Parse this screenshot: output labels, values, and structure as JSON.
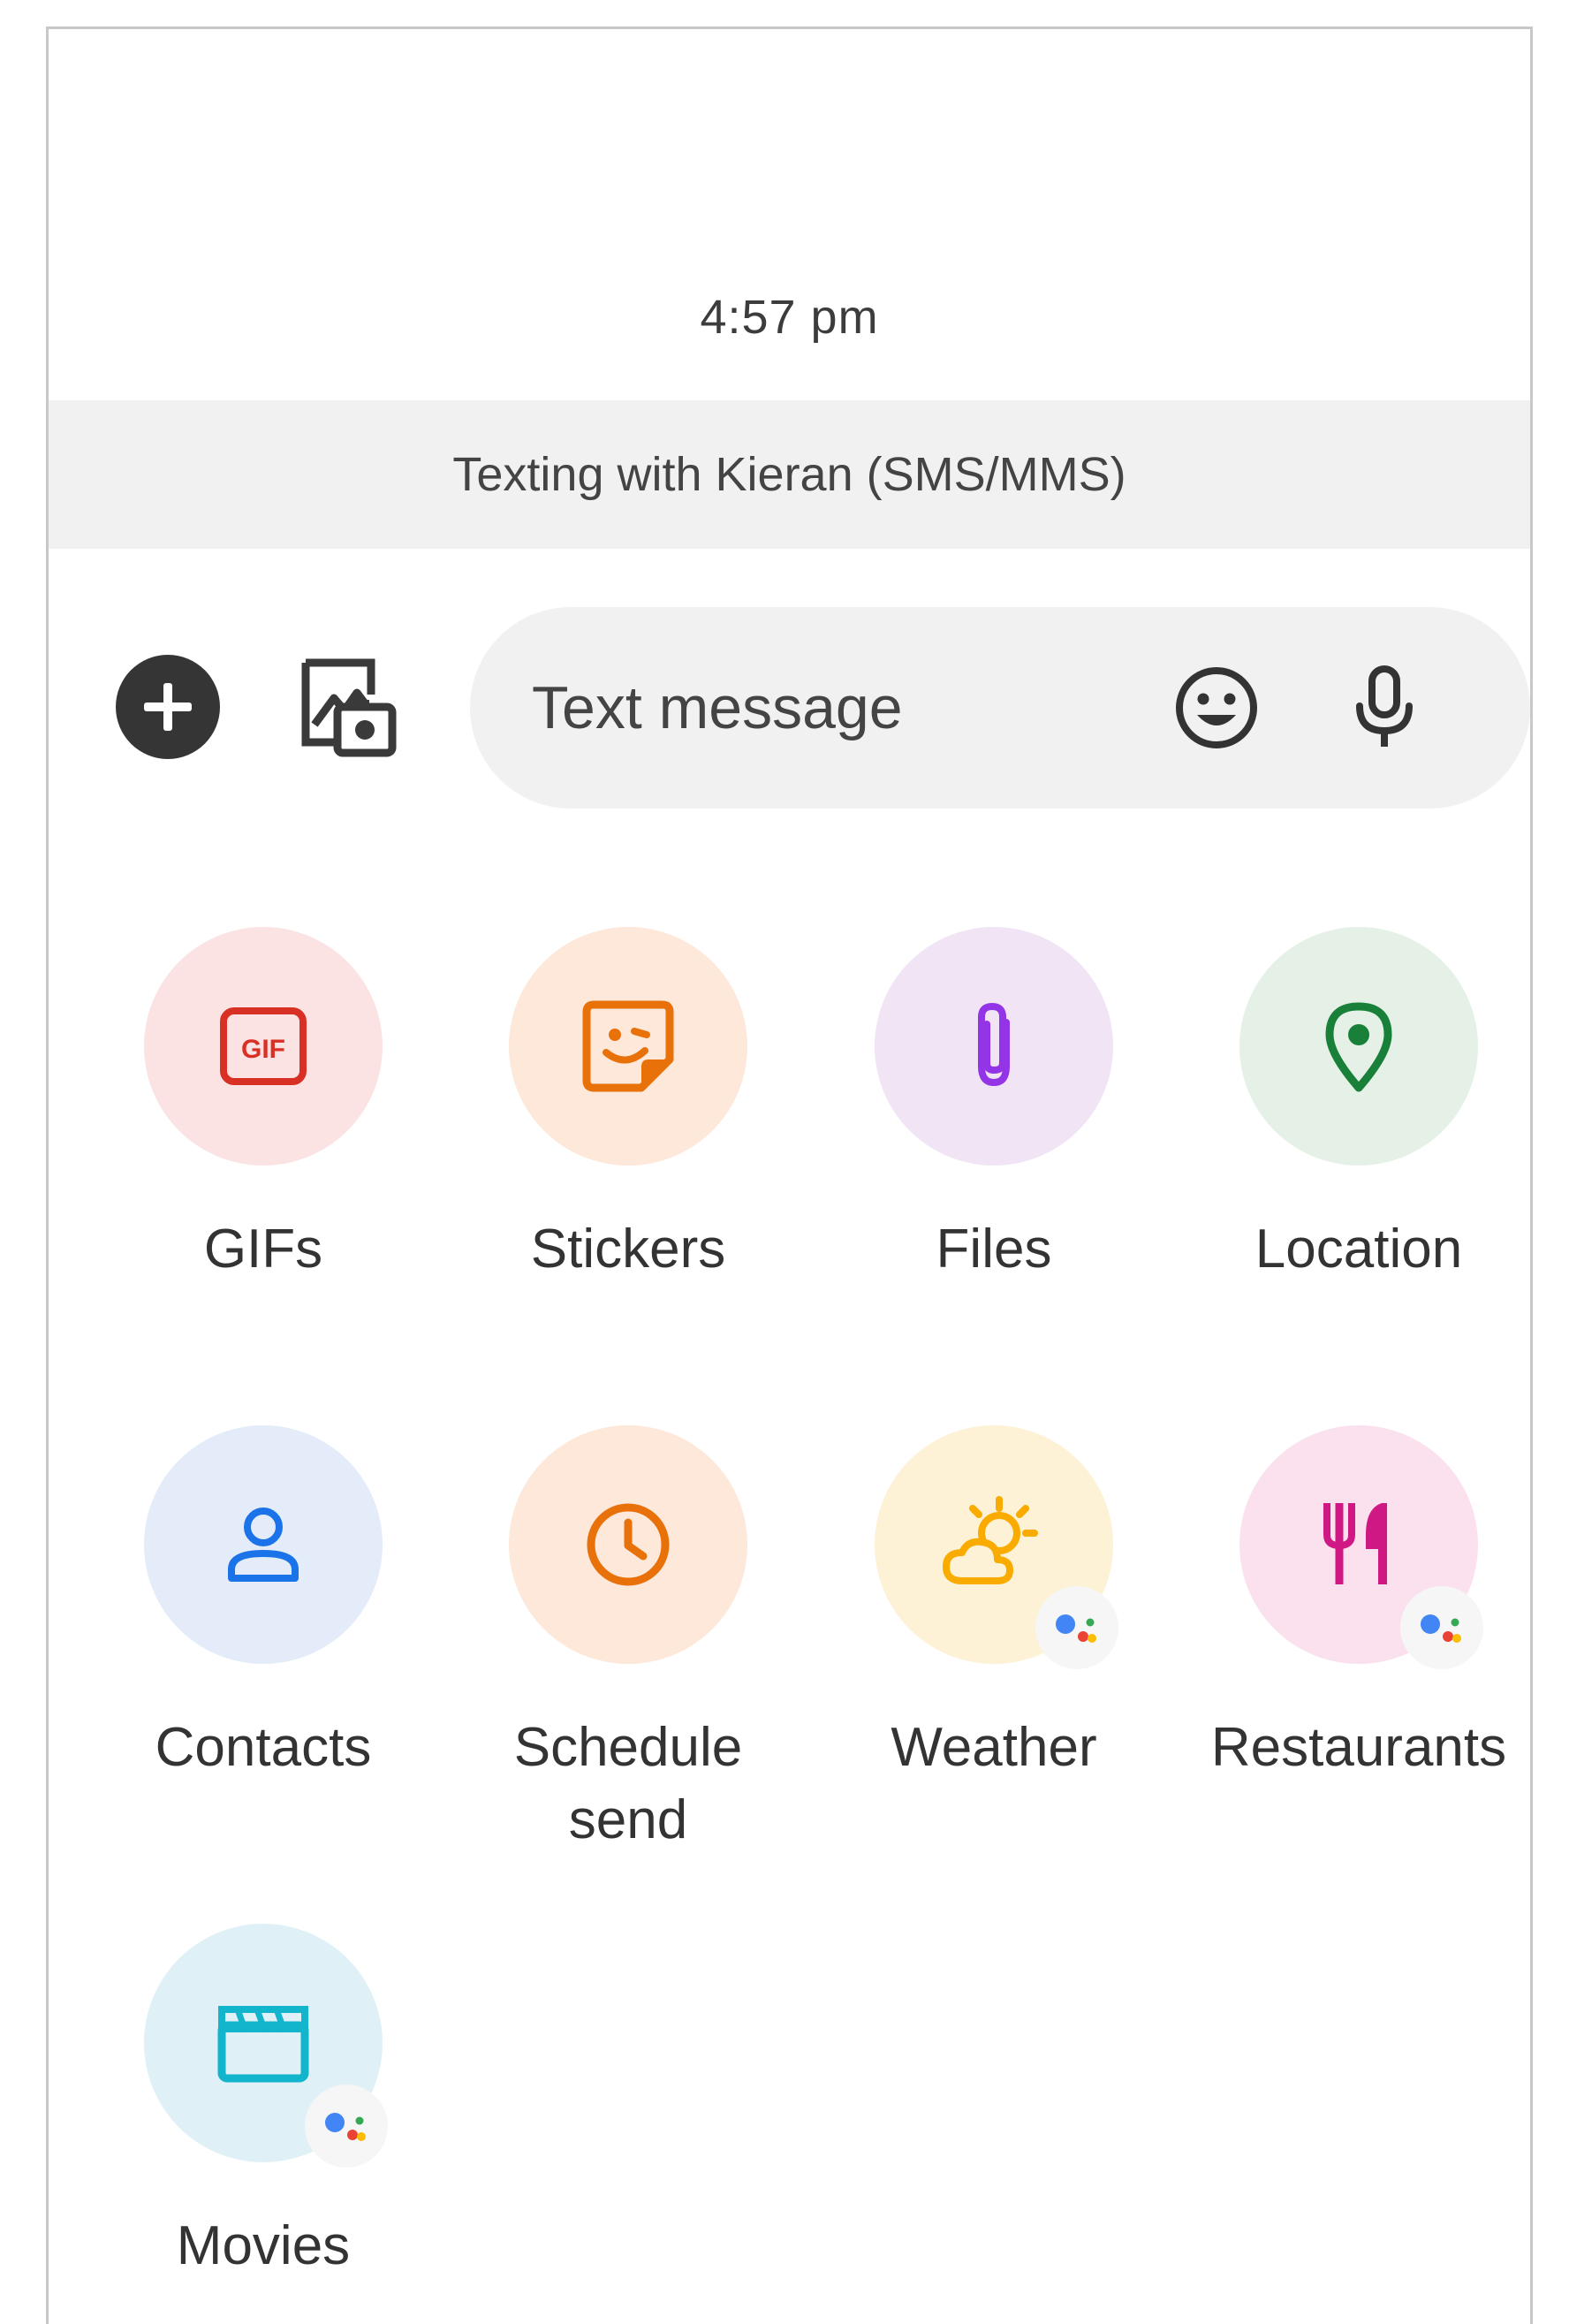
{
  "conversation": {
    "timestamp": "4:57 pm",
    "banner": "Texting with Kieran (SMS/MMS)"
  },
  "compose": {
    "plus_icon": "plus-icon",
    "gallery_icon": "gallery-camera-icon",
    "placeholder": "Text message",
    "emoji_icon": "emoji-icon",
    "mic_icon": "mic-icon"
  },
  "attachments": [
    {
      "label": "GIFs",
      "icon": "gif-icon",
      "bg": "#fbe3e3",
      "color": "#d93025",
      "assistant": false
    },
    {
      "label": "Stickers",
      "icon": "sticker-icon",
      "bg": "#fde8da",
      "color": "#e8710a",
      "assistant": false
    },
    {
      "label": "Files",
      "icon": "paperclip-icon",
      "bg": "#f1e4f5",
      "color": "#9334e6",
      "assistant": false
    },
    {
      "label": "Location",
      "icon": "location-pin-icon",
      "bg": "#e5f1e7",
      "color": "#188038",
      "assistant": false
    },
    {
      "label": "Contacts",
      "icon": "person-icon",
      "bg": "#e3ecf8",
      "color": "#1a73e8",
      "assistant": false
    },
    {
      "label": "Schedule send",
      "label_line1": "Schedule",
      "label_line2": "send",
      "icon": "clock-icon",
      "bg": "#fde8da",
      "color": "#e8710a",
      "assistant": false
    },
    {
      "label": "Weather",
      "icon": "weather-icon",
      "bg": "#fdf1d6",
      "color": "#f9ab00",
      "assistant": true
    },
    {
      "label": "Restaurants",
      "icon": "fork-knife-icon",
      "bg": "#fbe1ee",
      "color": "#d01884",
      "assistant": true
    },
    {
      "label": "Movies",
      "icon": "clapperboard-icon",
      "bg": "#dff1f6",
      "color": "#12b5cb",
      "assistant": true
    }
  ],
  "assistant_badge_icon": "assistant-icon",
  "colors": {
    "plus_bg": "#353535",
    "compose_bg": "#f2f1f1",
    "banner_bg": "#f1f1f2"
  }
}
